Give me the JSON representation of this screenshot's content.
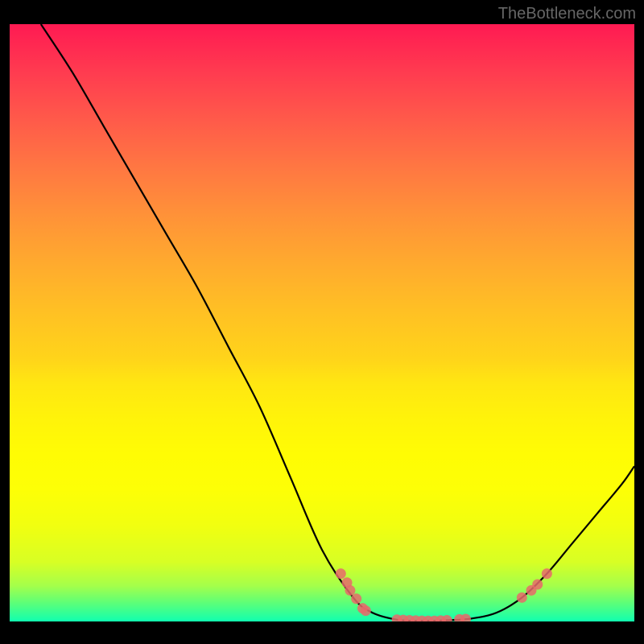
{
  "watermark": "TheBottleneck.com",
  "chart_data": {
    "type": "line",
    "title": "",
    "xlabel": "",
    "ylabel": "",
    "xlim": [
      0,
      100
    ],
    "ylim": [
      0,
      100
    ],
    "series": [
      {
        "name": "curve",
        "x": [
          5,
          10,
          15,
          20,
          25,
          30,
          35,
          40,
          45,
          50,
          55,
          58,
          62,
          66,
          70,
          74,
          78,
          82,
          86,
          90,
          94,
          98,
          100
        ],
        "y": [
          100,
          92,
          83,
          74,
          65,
          56,
          46,
          36,
          24,
          12,
          4,
          1.5,
          0.3,
          0.1,
          0.2,
          0.5,
          1.5,
          4,
          8,
          13,
          18,
          23,
          26
        ]
      }
    ],
    "markers": [
      {
        "x": 53,
        "y": 8
      },
      {
        "x": 54,
        "y": 6.5
      },
      {
        "x": 54.5,
        "y": 5.2
      },
      {
        "x": 55.5,
        "y": 3.8
      },
      {
        "x": 56.5,
        "y": 2.2
      },
      {
        "x": 57,
        "y": 1.8
      },
      {
        "x": 62,
        "y": 0.3
      },
      {
        "x": 63,
        "y": 0.25
      },
      {
        "x": 64,
        "y": 0.2
      },
      {
        "x": 65,
        "y": 0.15
      },
      {
        "x": 66,
        "y": 0.12
      },
      {
        "x": 67,
        "y": 0.1
      },
      {
        "x": 68,
        "y": 0.1
      },
      {
        "x": 69,
        "y": 0.15
      },
      {
        "x": 70,
        "y": 0.2
      },
      {
        "x": 72,
        "y": 0.35
      },
      {
        "x": 73,
        "y": 0.4
      },
      {
        "x": 82,
        "y": 4
      },
      {
        "x": 83.5,
        "y": 5.2
      },
      {
        "x": 84.5,
        "y": 6.2
      },
      {
        "x": 86,
        "y": 8
      }
    ]
  }
}
